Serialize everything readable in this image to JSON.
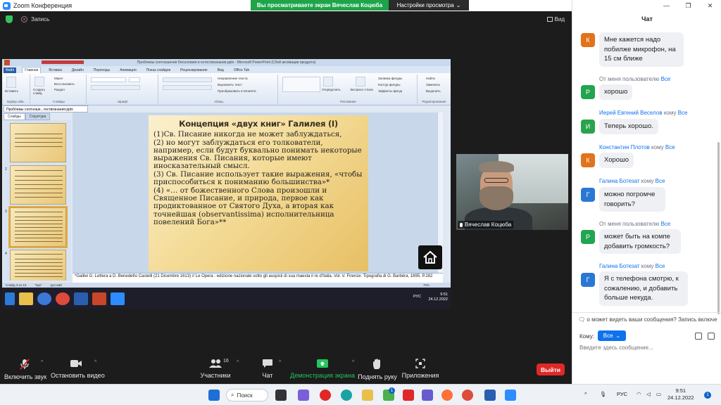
{
  "window": {
    "title": "Zoom Конференция"
  },
  "share_banner": {
    "viewing": "Вы просматриваете экран Вячеслав Коцюба",
    "view_options": "Настройки просмотра"
  },
  "meeting": {
    "recording": "Запись",
    "view": "Вид"
  },
  "powerpoint": {
    "title": "Проблемы соотношения богословия и естествознания.pptx - Microsoft PowerPoint (Сбой активации продукта)",
    "tabs": [
      "Файл",
      "Главная",
      "Вставка",
      "Дизайн",
      "Переходы",
      "Анимация",
      "Показ слайдов",
      "Рецензирование",
      "Вид",
      "Office Tab"
    ],
    "ribbon_groups": [
      "Буфер обм...",
      "Слайды",
      "Шрифт",
      "Абзац",
      "Рисование",
      "Редактирование"
    ],
    "ribbon_buttons": [
      "Вставить",
      "Создать слайд",
      "Макет",
      "Восстановить",
      "Раздел",
      "Направление текста",
      "Выровнять текст",
      "Преобразовать в SmartArt",
      "Упорядочить",
      "Экспресс-стили",
      "Заливка фигуры",
      "Контур фигуры",
      "Эффекты фигур",
      "Найти",
      "Заменить",
      "Выделить"
    ],
    "doc_tab": "Проблемы соотноше...тествознания.pptx",
    "pane_tabs": [
      "Слайды",
      "Структура"
    ],
    "slide_numbers": [
      "2",
      "3",
      "4"
    ],
    "slide": {
      "title": "Концепция «двух книг» Галилея (I)",
      "paragraphs": [
        "(1)Св. Писание никогда не может заблуждаться,",
        "(2) но могут заблуждаться его толкователи, например, если будут буквально понимать некоторые выражения Св. Писания, которые имеют иносказательный смысл.",
        "(3) Св. Писание использует такие выражения, «чтобы приспособиться к пониманию большинства»*",
        "(4) «… от божественного Слова произошли и Священное Писание, и природа, первое как продиктованное от Святого Духа, а вторая как точнейшая (observantissima) исполнительница повелений Бога»**"
      ]
    },
    "notes": "*Galilei G. Lettera a D. Benedetto Castelli (21 Dicembre 1613) // Le Opera : edizione nazionale sotto gli auspicii di sua maesta il re d'Italia. Vol. V. Firenze: Tipografia di G. Barbèra, 1895. P.282",
    "status": {
      "slide": "Слайд 3 из 15",
      "theme": "\"Бук\"",
      "lang": "русский",
      "zoom": "70%"
    },
    "taskbar": {
      "lang": "РУС",
      "time": "9:51",
      "date": "24.12.2022"
    }
  },
  "video": {
    "name": "Вячеслав Коцюба"
  },
  "toolbar": {
    "mute": "Включить звук",
    "video": "Остановить видео",
    "participants": "Участники",
    "participants_count": "16",
    "chat": "Чат",
    "share": "Демонстрация экрана",
    "raise_hand": "Поднять руку",
    "apps": "Приложения",
    "leave": "Выйти"
  },
  "chat": {
    "header": "Чат",
    "messages": [
      {
        "initial": "К",
        "avatar": "k",
        "meta_prefix": "",
        "meta_name": "",
        "meta_to": "",
        "meta_all": "",
        "text": "Мне кажется надо побилже микрофон, на 15 см ближе"
      },
      {
        "initial": "Р",
        "avatar": "r",
        "meta_prefix": "От меня пользователю",
        "meta_name": "",
        "meta_to": "",
        "meta_all": "Все",
        "text": "хорошо"
      },
      {
        "initial": "И",
        "avatar": "i",
        "meta_prefix": "",
        "meta_name": "Иерей Евгений Веселов",
        "meta_to": "кому",
        "meta_all": "Все",
        "text": "Теперь хорошо."
      },
      {
        "initial": "К",
        "avatar": "k",
        "meta_prefix": "",
        "meta_name": "Константин Плотов",
        "meta_to": "кому",
        "meta_all": "Все",
        "text": "Хорошо"
      },
      {
        "initial": "Г",
        "avatar": "g",
        "meta_prefix": "",
        "meta_name": "Галина Ботезат",
        "meta_to": "кому",
        "meta_all": "Все",
        "text": "можно погромче говорить?"
      },
      {
        "initial": "Р",
        "avatar": "r",
        "meta_prefix": "От меня пользователю",
        "meta_name": "",
        "meta_to": "",
        "meta_all": "Все",
        "text": "может быть на компе добавить громкость?"
      },
      {
        "initial": "Г",
        "avatar": "g",
        "meta_prefix": "",
        "meta_name": "Галина Ботезат",
        "meta_to": "кому",
        "meta_all": "Все",
        "text": "Я с телефона смотрю, к сожалению, и добавить больше некуда."
      }
    ],
    "who_sees": "о может видеть ваши сообщения? Запись включе",
    "to_label": "Кому:",
    "to_value": "Все",
    "input_placeholder": "Введите здесь сообщение..."
  },
  "taskbar": {
    "search": "Поиск",
    "lang": "РУС",
    "time": "9:51",
    "date": "24.12.2022",
    "notif": "1",
    "badge": "1"
  }
}
